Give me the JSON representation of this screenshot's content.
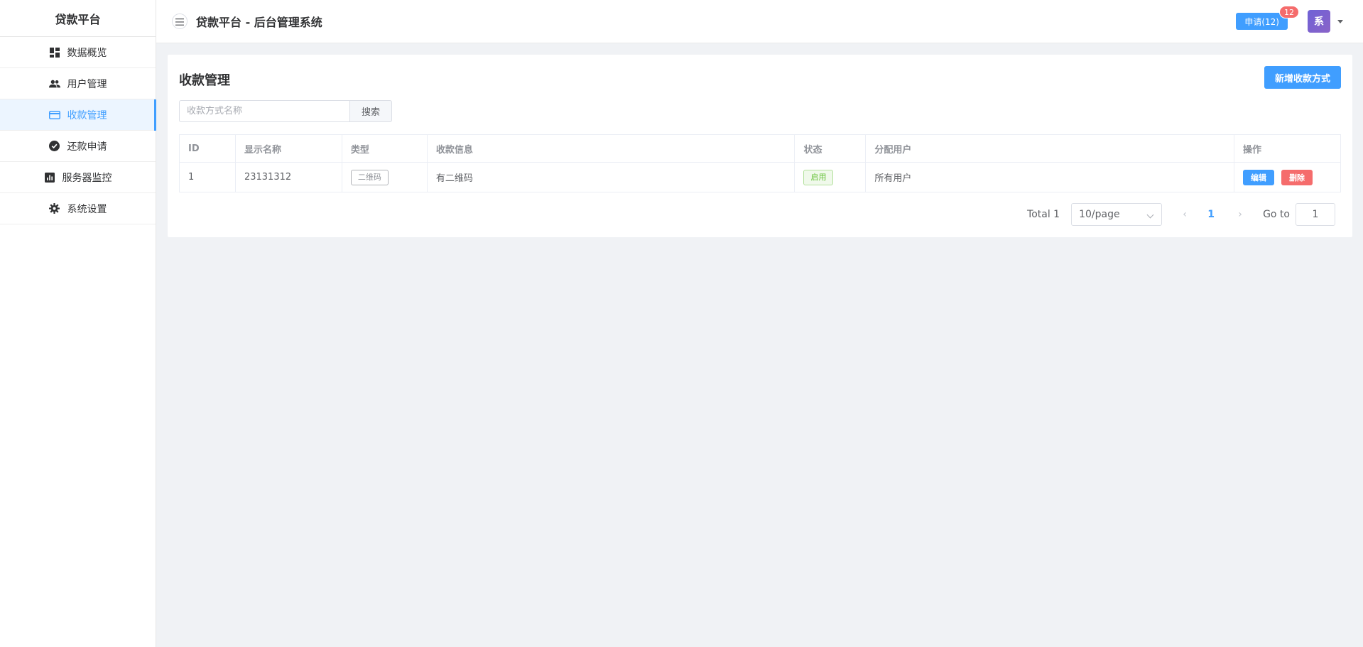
{
  "sidebar": {
    "brand": "贷款平台",
    "items": [
      {
        "label": "数据概览",
        "icon": "dashboard-icon"
      },
      {
        "label": "用户管理",
        "icon": "users-icon"
      },
      {
        "label": "收款管理",
        "icon": "credit-card-icon",
        "active": true
      },
      {
        "label": "还款申请",
        "icon": "check-circle-icon"
      },
      {
        "label": "服务器监控",
        "icon": "chart-icon"
      },
      {
        "label": "系统设置",
        "icon": "gear-icon"
      }
    ]
  },
  "header": {
    "title": "贷款平台 - 后台管理系统",
    "apply_label": "申请(12)",
    "apply_badge": "12",
    "avatar_text": "系"
  },
  "main": {
    "title": "收款管理",
    "add_button": "新增收款方式",
    "search": {
      "placeholder": "收款方式名称",
      "value": "",
      "button": "搜索"
    },
    "table": {
      "headers": [
        "ID",
        "显示名称",
        "类型",
        "收款信息",
        "状态",
        "分配用户",
        "操作"
      ],
      "rows": [
        {
          "id": "1",
          "name": "23131312",
          "type": "二维码",
          "info": "有二维码",
          "status": "启用",
          "assigned": "所有用户",
          "edit": "编辑",
          "delete": "删除"
        }
      ]
    },
    "pagination": {
      "total": "Total 1",
      "page_size": "10/page",
      "current_page": "1",
      "goto_label": "Go to",
      "goto_value": "1"
    }
  },
  "colors": {
    "primary": "#409eff",
    "danger": "#f56c6c",
    "success": "#67c23a",
    "avatar": "#7b63d0"
  }
}
